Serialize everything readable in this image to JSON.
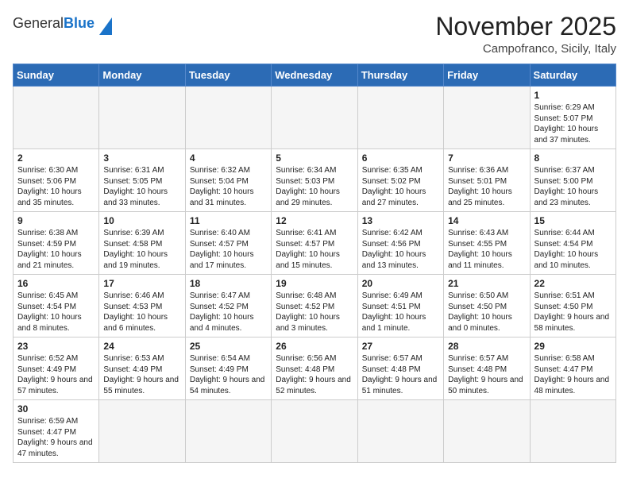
{
  "logo": {
    "general": "General",
    "blue": "Blue"
  },
  "title": "November 2025",
  "subtitle": "Campofranco, Sicily, Italy",
  "days_of_week": [
    "Sunday",
    "Monday",
    "Tuesday",
    "Wednesday",
    "Thursday",
    "Friday",
    "Saturday"
  ],
  "weeks": [
    [
      {
        "day": "",
        "info": ""
      },
      {
        "day": "",
        "info": ""
      },
      {
        "day": "",
        "info": ""
      },
      {
        "day": "",
        "info": ""
      },
      {
        "day": "",
        "info": ""
      },
      {
        "day": "",
        "info": ""
      },
      {
        "day": "1",
        "info": "Sunrise: 6:29 AM\nSunset: 5:07 PM\nDaylight: 10 hours and 37 minutes."
      }
    ],
    [
      {
        "day": "2",
        "info": "Sunrise: 6:30 AM\nSunset: 5:06 PM\nDaylight: 10 hours and 35 minutes."
      },
      {
        "day": "3",
        "info": "Sunrise: 6:31 AM\nSunset: 5:05 PM\nDaylight: 10 hours and 33 minutes."
      },
      {
        "day": "4",
        "info": "Sunrise: 6:32 AM\nSunset: 5:04 PM\nDaylight: 10 hours and 31 minutes."
      },
      {
        "day": "5",
        "info": "Sunrise: 6:34 AM\nSunset: 5:03 PM\nDaylight: 10 hours and 29 minutes."
      },
      {
        "day": "6",
        "info": "Sunrise: 6:35 AM\nSunset: 5:02 PM\nDaylight: 10 hours and 27 minutes."
      },
      {
        "day": "7",
        "info": "Sunrise: 6:36 AM\nSunset: 5:01 PM\nDaylight: 10 hours and 25 minutes."
      },
      {
        "day": "8",
        "info": "Sunrise: 6:37 AM\nSunset: 5:00 PM\nDaylight: 10 hours and 23 minutes."
      }
    ],
    [
      {
        "day": "9",
        "info": "Sunrise: 6:38 AM\nSunset: 4:59 PM\nDaylight: 10 hours and 21 minutes."
      },
      {
        "day": "10",
        "info": "Sunrise: 6:39 AM\nSunset: 4:58 PM\nDaylight: 10 hours and 19 minutes."
      },
      {
        "day": "11",
        "info": "Sunrise: 6:40 AM\nSunset: 4:57 PM\nDaylight: 10 hours and 17 minutes."
      },
      {
        "day": "12",
        "info": "Sunrise: 6:41 AM\nSunset: 4:57 PM\nDaylight: 10 hours and 15 minutes."
      },
      {
        "day": "13",
        "info": "Sunrise: 6:42 AM\nSunset: 4:56 PM\nDaylight: 10 hours and 13 minutes."
      },
      {
        "day": "14",
        "info": "Sunrise: 6:43 AM\nSunset: 4:55 PM\nDaylight: 10 hours and 11 minutes."
      },
      {
        "day": "15",
        "info": "Sunrise: 6:44 AM\nSunset: 4:54 PM\nDaylight: 10 hours and 10 minutes."
      }
    ],
    [
      {
        "day": "16",
        "info": "Sunrise: 6:45 AM\nSunset: 4:54 PM\nDaylight: 10 hours and 8 minutes."
      },
      {
        "day": "17",
        "info": "Sunrise: 6:46 AM\nSunset: 4:53 PM\nDaylight: 10 hours and 6 minutes."
      },
      {
        "day": "18",
        "info": "Sunrise: 6:47 AM\nSunset: 4:52 PM\nDaylight: 10 hours and 4 minutes."
      },
      {
        "day": "19",
        "info": "Sunrise: 6:48 AM\nSunset: 4:52 PM\nDaylight: 10 hours and 3 minutes."
      },
      {
        "day": "20",
        "info": "Sunrise: 6:49 AM\nSunset: 4:51 PM\nDaylight: 10 hours and 1 minute."
      },
      {
        "day": "21",
        "info": "Sunrise: 6:50 AM\nSunset: 4:50 PM\nDaylight: 10 hours and 0 minutes."
      },
      {
        "day": "22",
        "info": "Sunrise: 6:51 AM\nSunset: 4:50 PM\nDaylight: 9 hours and 58 minutes."
      }
    ],
    [
      {
        "day": "23",
        "info": "Sunrise: 6:52 AM\nSunset: 4:49 PM\nDaylight: 9 hours and 57 minutes."
      },
      {
        "day": "24",
        "info": "Sunrise: 6:53 AM\nSunset: 4:49 PM\nDaylight: 9 hours and 55 minutes."
      },
      {
        "day": "25",
        "info": "Sunrise: 6:54 AM\nSunset: 4:49 PM\nDaylight: 9 hours and 54 minutes."
      },
      {
        "day": "26",
        "info": "Sunrise: 6:56 AM\nSunset: 4:48 PM\nDaylight: 9 hours and 52 minutes."
      },
      {
        "day": "27",
        "info": "Sunrise: 6:57 AM\nSunset: 4:48 PM\nDaylight: 9 hours and 51 minutes."
      },
      {
        "day": "28",
        "info": "Sunrise: 6:57 AM\nSunset: 4:48 PM\nDaylight: 9 hours and 50 minutes."
      },
      {
        "day": "29",
        "info": "Sunrise: 6:58 AM\nSunset: 4:47 PM\nDaylight: 9 hours and 48 minutes."
      }
    ],
    [
      {
        "day": "30",
        "info": "Sunrise: 6:59 AM\nSunset: 4:47 PM\nDaylight: 9 hours and 47 minutes."
      },
      {
        "day": "",
        "info": ""
      },
      {
        "day": "",
        "info": ""
      },
      {
        "day": "",
        "info": ""
      },
      {
        "day": "",
        "info": ""
      },
      {
        "day": "",
        "info": ""
      },
      {
        "day": "",
        "info": ""
      }
    ]
  ]
}
